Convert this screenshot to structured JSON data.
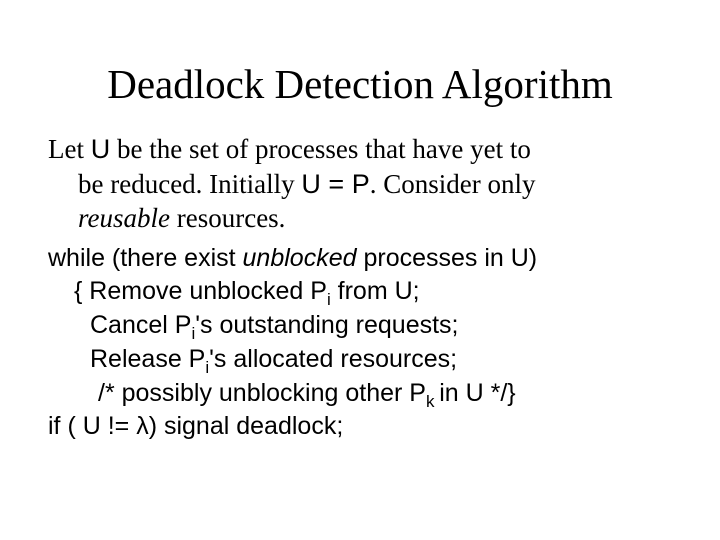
{
  "title": "Deadlock Detection Algorithm",
  "intro": {
    "p1a": "Let ",
    "p1b": "U",
    "p1c": " be the set of processes that have yet to",
    "p2a": "be reduced.  Initially ",
    "p2b": "U = P",
    "p2c": ". Consider only",
    "p3a": "reusable",
    "p3b": " resources."
  },
  "algo": {
    "l1a": "while (there exist ",
    "l1b": "unblocked",
    "l1c": " processes in U)",
    "l2a": "{ Remove unblocked P",
    "l2b": "i",
    "l2c": " from U;",
    "l3a": "Cancel P",
    "l3b": "i",
    "l3c": "'s outstanding requests;",
    "l4a": "Release P",
    "l4b": "i",
    "l4c": "'s allocated resources;",
    "l5a": "/* possibly unblocking other P",
    "l5b": "k ",
    "l5c": "in U */}",
    "l6": "if ( U != λ) signal deadlock;"
  }
}
